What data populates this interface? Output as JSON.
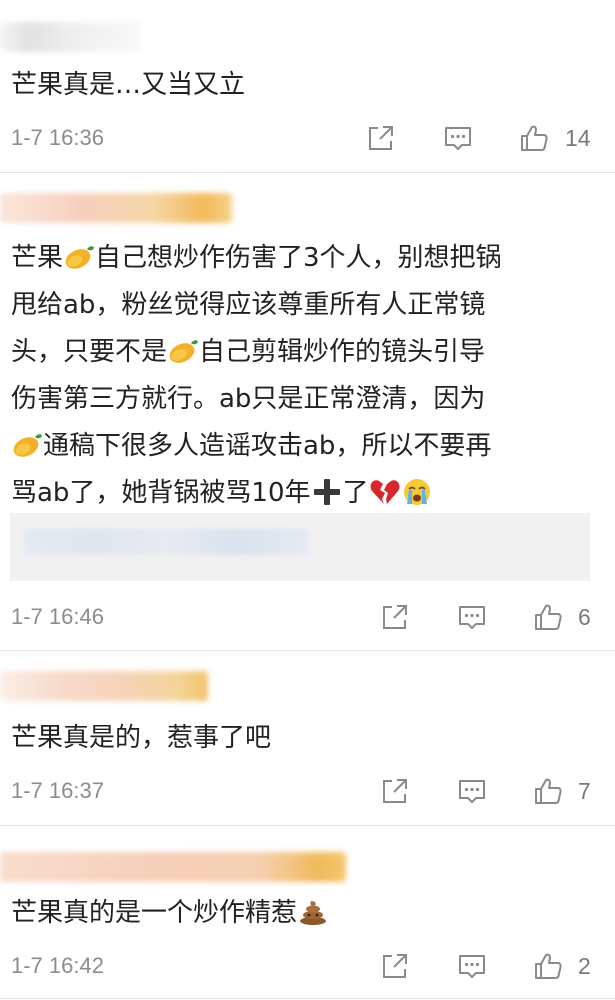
{
  "comments": [
    {
      "text": "芒果真是…又当又立",
      "time": "1-7 16:36",
      "likes": "14"
    },
    {
      "text_segments": [
        "芒果",
        "自己想炒作伤害了3个人，别想把锅\n甩给ab，粉丝觉得应该尊重所有人正常镜\n头，只要不是",
        "自己剪辑炒作的镜头引导\n伤害第三方就行。ab只是正常澄清，因为\n",
        "通稿下很多人造谣攻击ab，所以不要再\n骂ab了，她背锅被骂10年",
        "了"
      ],
      "emoji": [
        "mango",
        "mango",
        "mango",
        "heavy-plus",
        "broken-heart",
        "crying-face"
      ],
      "time": "1-7 16:46",
      "likes": "6"
    },
    {
      "text": "芒果真是的，惹事了吧",
      "time": "1-7 16:37",
      "likes": "7"
    },
    {
      "text": "芒果真的是一个炒作精惹",
      "emoji": [
        "pile-of-poo"
      ],
      "time": "1-7 16:42",
      "likes": "2"
    }
  ],
  "icons": {
    "share": "share-icon",
    "reply": "reply-icon",
    "like": "thumbs-up-icon"
  },
  "colors": {
    "text": "#222222",
    "meta": "#8c8c8c",
    "icon": "#8a8a8a",
    "divider": "#e6e6e6"
  }
}
